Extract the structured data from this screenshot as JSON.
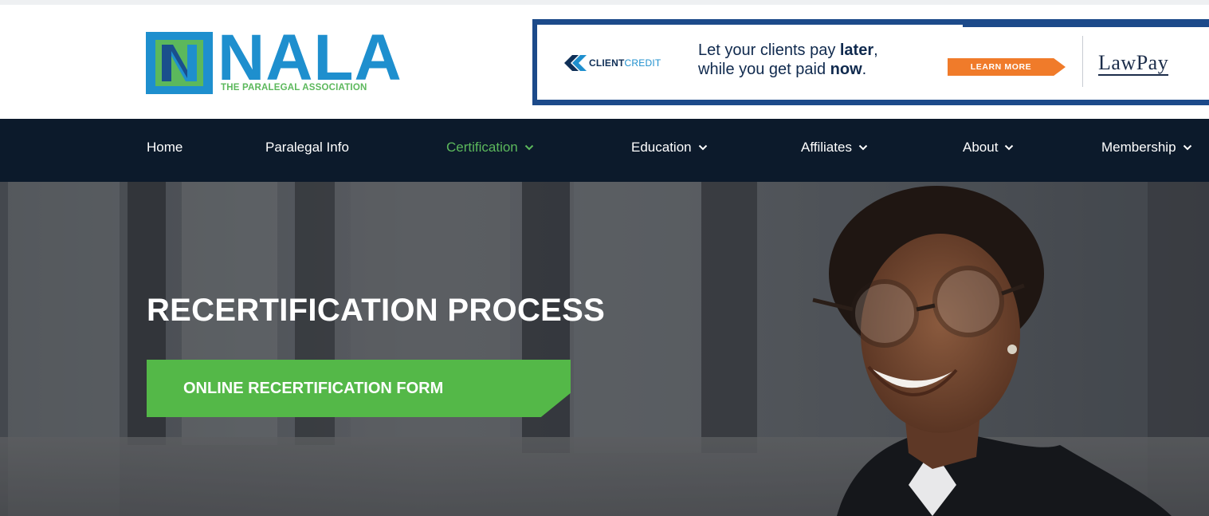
{
  "logo": {
    "wordmark": "NALA",
    "tagline": "THE PARALEGAL ASSOCIATION",
    "colors": {
      "blue": "#1e8fce",
      "green": "#5cb85c"
    }
  },
  "ad": {
    "brand_bold": "CLIENT",
    "brand_light": "CREDIT",
    "line1_prefix": "Let your clients pay ",
    "line1_bold": "later",
    "line1_suffix": ",",
    "line2_prefix": "while you get paid ",
    "line2_bold": "now",
    "line2_suffix": ".",
    "cta": "LEARN MORE",
    "partner": "LawPay",
    "colors": {
      "frame": "#1c4a8a",
      "cta": "#f07b2a"
    }
  },
  "nav": {
    "items": [
      {
        "label": "Home",
        "dropdown": false,
        "active": false
      },
      {
        "label": "Paralegal Info",
        "dropdown": false,
        "active": false
      },
      {
        "label": "Certification",
        "dropdown": true,
        "active": true
      },
      {
        "label": "Education",
        "dropdown": true,
        "active": false
      },
      {
        "label": "Affiliates",
        "dropdown": true,
        "active": false
      },
      {
        "label": "About",
        "dropdown": true,
        "active": false
      },
      {
        "label": "Membership",
        "dropdown": true,
        "active": false
      }
    ],
    "colors": {
      "background": "#0c1a2b",
      "active": "#5cb85c"
    }
  },
  "hero": {
    "title": "RECERTIFICATION PROCESS",
    "button": "ONLINE RECERTIFICATION FORM",
    "colors": {
      "button": "#54b848"
    }
  }
}
